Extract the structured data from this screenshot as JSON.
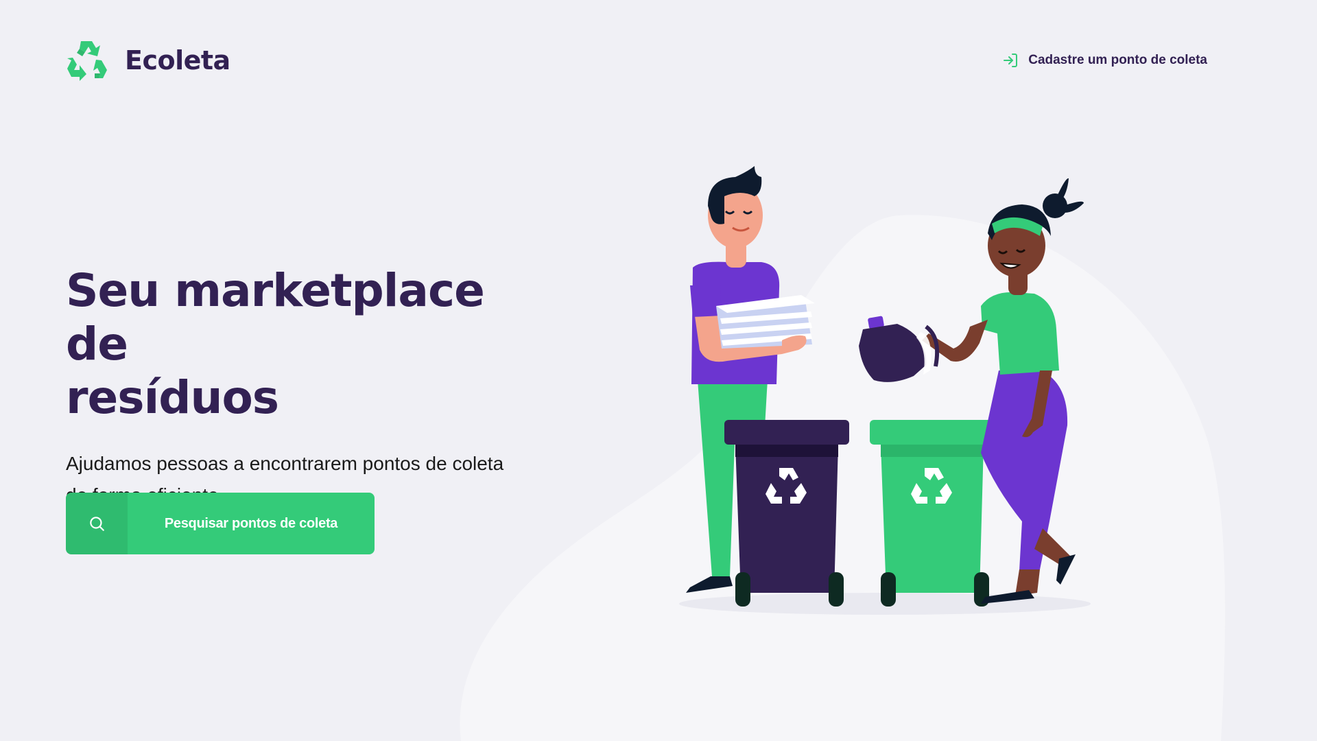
{
  "app": {
    "name": "Ecoleta",
    "logo_icon": "recycle-icon"
  },
  "header": {
    "register_link_label": "Cadastre um ponto de coleta",
    "register_link_icon": "log-in-icon"
  },
  "hero": {
    "title_line1": "Seu marketplace de",
    "title_line2": "resíduos",
    "description_line1": "Ajudamos pessoas a encontrarem pontos de coleta",
    "description_line2": "de forma eficiente"
  },
  "search_button": {
    "label": "Pesquisar pontos de coleta",
    "icon": "search-icon"
  },
  "colors": {
    "primary": "#34CB79",
    "title": "#322153",
    "background": "#F0F0F5",
    "purple": "#6C35D0"
  }
}
